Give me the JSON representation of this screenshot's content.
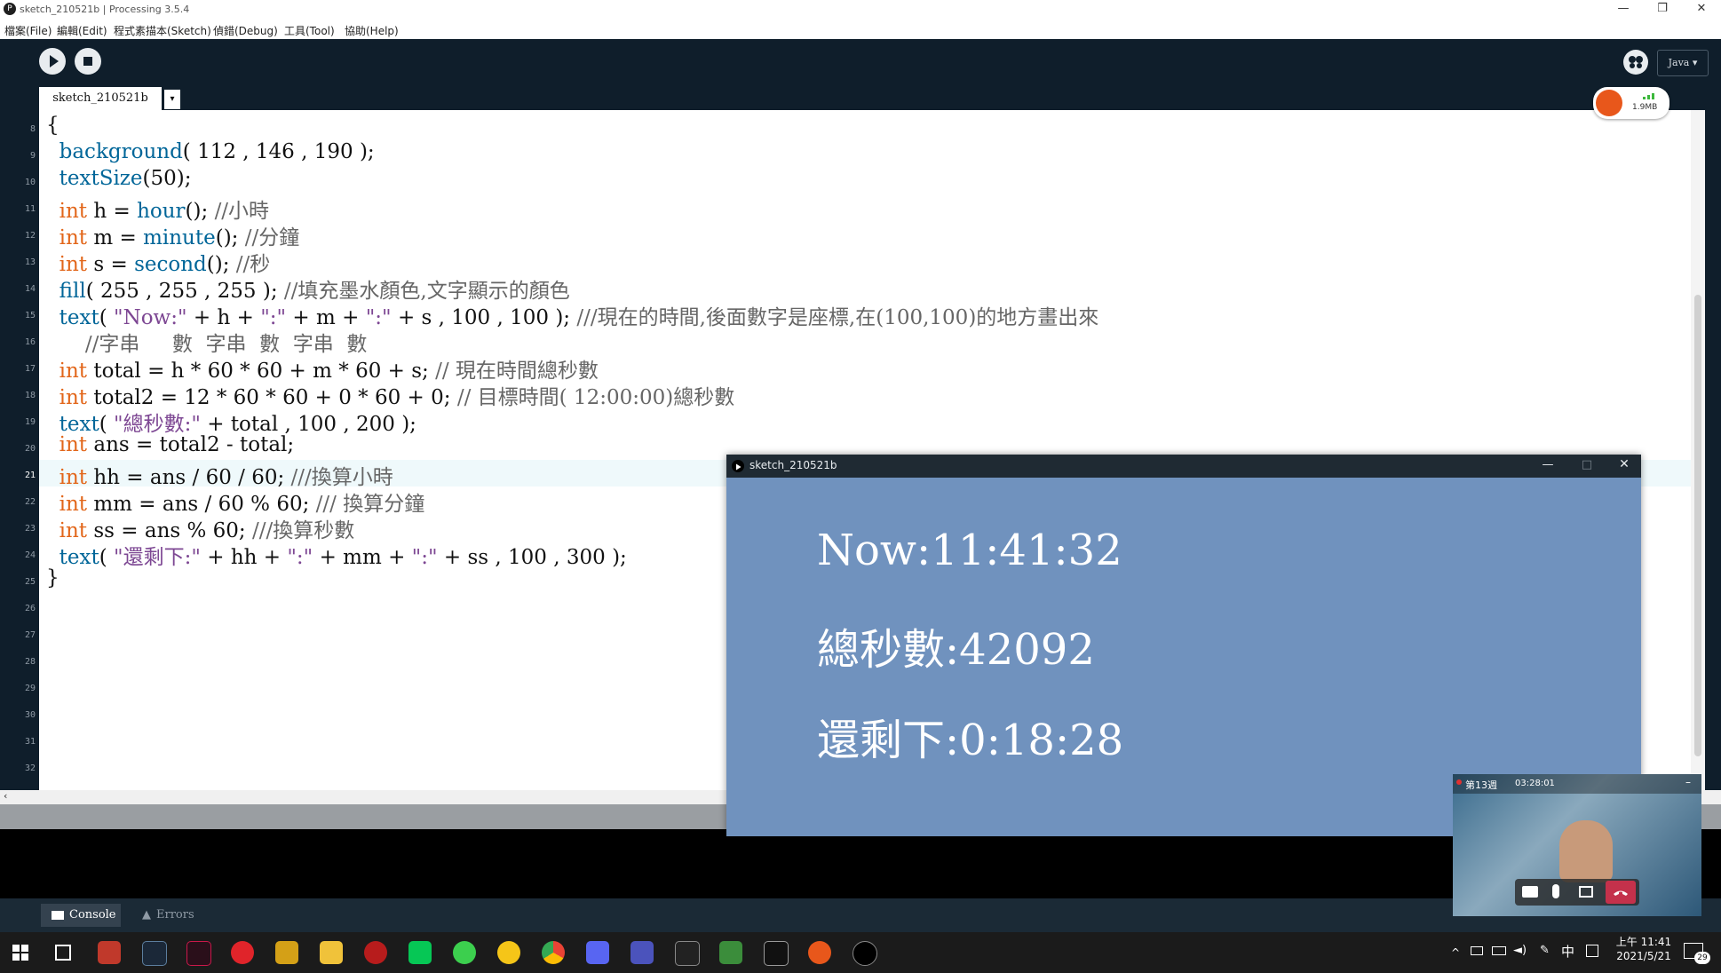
{
  "window": {
    "title": "sketch_210521b | Processing 3.5.4",
    "controls": [
      "—",
      "❐",
      "✕"
    ]
  },
  "menu": [
    "檔案(File)",
    "編輯(Edit)",
    "程式素描本(Sketch)",
    "偵錯(Debug)",
    "工具(Tool)",
    "協助(Help)"
  ],
  "toolbar": {
    "mode_label": "Java ▾",
    "memory_label": "1.9MB"
  },
  "tab": {
    "label": "sketch_210521b",
    "arrow": "▾"
  },
  "editor": {
    "line_numbers": [
      "8",
      "9",
      "10",
      "11",
      "12",
      "13",
      "14",
      "15",
      "16",
      "17",
      "18",
      "19",
      "20",
      "21",
      "22",
      "23",
      "24",
      "25",
      "26",
      "27",
      "28",
      "29",
      "30",
      "31",
      "32"
    ],
    "lines": [
      "{",
      "  background( 112 , 146 , 190 );",
      "  textSize(50);",
      "  int h = hour(); //小時",
      "  int m = minute(); //分鐘",
      "  int s = second(); //秒",
      "  fill( 255 , 255 , 255 ); //填充墨水顏色,文字顯示的顏色",
      "  text( \"Now:\" + h + \":\" + m + \":\" + s , 100 , 100 ); ///現在的時間,後面數字是座標,在(100,100)的地方畫出來",
      "      //字串     數  字串  數  字串  數",
      "  int total = h * 60 * 60 + m * 60 + s; // 現在時間總秒數",
      "  int total2 = 12 * 60 * 60 + 0 * 60 + 0; // 目標時間( 12:00:00)總秒數",
      "  text( \"總秒數:\" + total , 100 , 200 );",
      "  int ans = total2 - total;",
      "  int hh = ans / 60 / 60; ///換算小時",
      "  int mm = ans / 60 % 60; /// 換算分鐘",
      "  int ss = ans % 60; ///換算秒數",
      "  text( \"還剩下:\" + hh + \":\" + mm + \":\" + ss , 100 , 300 );",
      "}"
    ]
  },
  "console": {
    "tabs": [
      "Console",
      "Errors"
    ]
  },
  "sketch_window": {
    "title": "sketch_210521b",
    "controls": [
      "—",
      "□",
      "✕"
    ],
    "background": "#7092be",
    "text_lines": [
      "Now:11:41:32",
      "總秒數:42092",
      "還剩下:0:18:28"
    ]
  },
  "video_call": {
    "title": "第13週",
    "duration": "03:28:01"
  },
  "taskbar": {
    "time": "上午 11:41",
    "date": "2021/5/21",
    "ime": "中",
    "notification_count": "29"
  },
  "colors": {
    "keyword": "#e2661a",
    "function": "#006699",
    "string": "#7d4793",
    "comment": "#666666",
    "ide_dark": "#0f1e2b"
  }
}
